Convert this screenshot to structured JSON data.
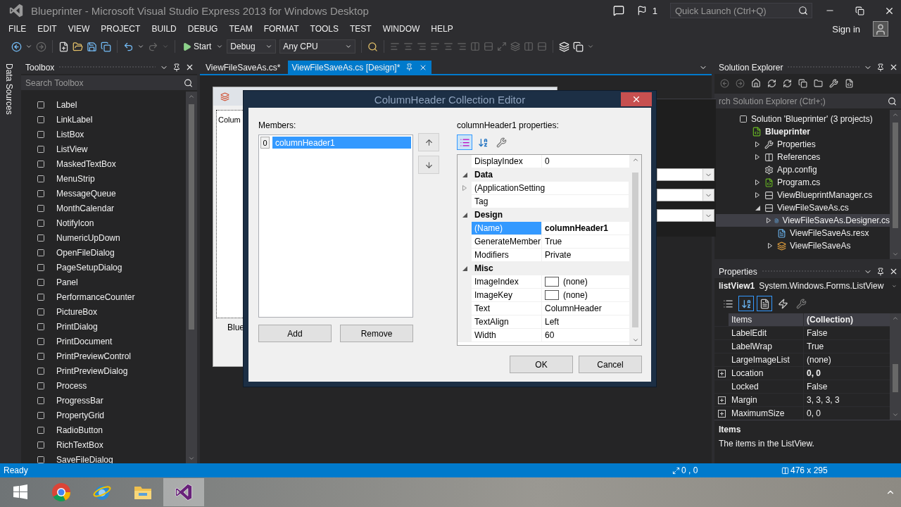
{
  "window": {
    "title": "Blueprinter - Microsoft Visual Studio Express 2013 for Windows Desktop",
    "notification_count": "1",
    "quick_launch": {
      "placeholder": "Quick Launch (Ctrl+Q)"
    },
    "sign_in": "Sign in"
  },
  "menu": [
    "FILE",
    "EDIT",
    "VIEW",
    "PROJECT",
    "BUILD",
    "DEBUG",
    "TEAM",
    "FORMAT",
    "TOOLS",
    "TEST",
    "WINDOW",
    "HELP"
  ],
  "toolbar": {
    "start": "Start",
    "configuration": "Debug",
    "platform": "Any CPU"
  },
  "side_tab": "Data Sources",
  "toolbox": {
    "title": "Toolbox",
    "search": {
      "placeholder": "Search Toolbox"
    },
    "items": [
      "Label",
      "LinkLabel",
      "ListBox",
      "ListView",
      "MaskedTextBox",
      "MenuStrip",
      "MessageQueue",
      "MonthCalendar",
      "NotifyIcon",
      "NumericUpDown",
      "OpenFileDialog",
      "PageSetupDialog",
      "Panel",
      "PerformanceCounter",
      "PictureBox",
      "PrintDialog",
      "PrintDocument",
      "PrintPreviewControl",
      "PrintPreviewDialog",
      "Process",
      "ProgressBar",
      "PropertyGrid",
      "RadioButton",
      "RichTextBox",
      "SaveFileDialog"
    ]
  },
  "document_tabs": [
    {
      "label": "ViewFileSaveAs.cs*",
      "selected": false
    },
    {
      "label": "ViewFileSaveAs.cs [Design]*",
      "selected": true
    }
  ],
  "designer": {
    "list_header": "Colum",
    "label": "Blue"
  },
  "dialog": {
    "title": "ColumnHeader Collection Editor",
    "members_label": "Members:",
    "members": [
      {
        "index": "0",
        "name": "columnHeader1",
        "selected": true
      }
    ],
    "add": "Add",
    "remove": "Remove",
    "properties_label": "columnHeader1 properties:",
    "view_buttons": [
      {
        "kind": "categorized",
        "selected": true
      },
      {
        "kind": "alphabetical",
        "selected": false
      },
      {
        "kind": "pages",
        "selected": false
      }
    ],
    "rows": [
      {
        "kind": "property",
        "name": "DisplayIndex",
        "value": "0",
        "selected": false,
        "bold": false
      },
      {
        "kind": "category",
        "name": "Data",
        "expanded": true
      },
      {
        "kind": "property",
        "name": "(ApplicationSetting",
        "expanded": false,
        "selected": false
      },
      {
        "kind": "property",
        "name": "Tag",
        "selected": false
      },
      {
        "kind": "category",
        "name": "Design",
        "expanded": true
      },
      {
        "kind": "property",
        "name": "(Name)",
        "value": "columnHeader1",
        "selected": true,
        "bold": true
      },
      {
        "kind": "property",
        "name": "GenerateMember",
        "value": "True",
        "selected": false,
        "bold": false
      },
      {
        "kind": "property",
        "name": "Modifiers",
        "value": "Private",
        "selected": false,
        "bold": false
      },
      {
        "kind": "category",
        "name": "Misc",
        "expanded": true
      },
      {
        "kind": "swatch",
        "name": "ImageIndex",
        "value": "(none)",
        "selected": false,
        "bold": false
      },
      {
        "kind": "swatch",
        "name": "ImageKey",
        "value": "(none)",
        "selected": false,
        "bold": false
      },
      {
        "kind": "property",
        "name": "Text",
        "value": "ColumnHeader",
        "selected": false,
        "bold": false
      },
      {
        "kind": "property",
        "name": "TextAlign",
        "value": "Left",
        "selected": false,
        "bold": false
      },
      {
        "kind": "property",
        "name": "Width",
        "value": "60",
        "selected": false,
        "bold": false
      }
    ],
    "ok": "OK",
    "cancel": "Cancel"
  },
  "solution_explorer": {
    "title": "Solution Explorer",
    "search": {
      "placeholder": "rch Solution Explorer (Ctrl+;)"
    },
    "tree": [
      {
        "label": "Solution 'Blueprinter' (3 projects)",
        "kind": "solution",
        "selected": false,
        "children": [
          {
            "label": "Blueprinter",
            "kind": "project",
            "selected": false,
            "children": [
              {
                "label": "Properties",
                "kind": "properties",
                "expanded": false,
                "selected": false
              },
              {
                "label": "References",
                "kind": "references",
                "expanded": false,
                "selected": false
              },
              {
                "label": "App.config",
                "kind": "config",
                "selected": false
              },
              {
                "label": "Program.cs",
                "kind": "csharp",
                "expanded": false,
                "selected": false
              },
              {
                "label": "ViewBlueprintManager.cs",
                "kind": "form",
                "expanded": false,
                "selected": false
              },
              {
                "label": "ViewFileSaveAs.cs",
                "kind": "form",
                "expanded": true,
                "selected": false,
                "children": [
                  {
                    "label": "ViewFileSaveAs.Designer.cs",
                    "kind": "file",
                    "expanded": false,
                    "selected": true
                  },
                  {
                    "label": "ViewFileSaveAs.resx",
                    "kind": "file",
                    "selected": false
                  },
                  {
                    "label": "ViewFileSaveAs",
                    "kind": "class",
                    "expanded": false,
                    "selected": false
                  }
                ]
              }
            ]
          }
        ]
      }
    ]
  },
  "properties": {
    "title": "Properties",
    "object": "listView1",
    "type": "System.Windows.Forms.ListView",
    "view_buttons": [
      {
        "kind": "categorized",
        "selected": false
      },
      {
        "kind": "alphabetical",
        "selected": true
      },
      {
        "kind": "properties",
        "selected": true
      },
      {
        "kind": "events",
        "selected": false
      },
      {
        "kind": "pages",
        "selected": false
      }
    ],
    "rows": [
      {
        "kind": "property",
        "name": "Items",
        "value": "(Collection)",
        "selected": true,
        "bold": true
      },
      {
        "kind": "property",
        "name": "LabelEdit",
        "value": "False",
        "selected": false,
        "bold": false
      },
      {
        "kind": "property",
        "name": "LabelWrap",
        "value": "True",
        "selected": false,
        "bold": false
      },
      {
        "kind": "property",
        "name": "LargeImageList",
        "value": "(none)",
        "selected": false,
        "bold": false
      },
      {
        "kind": "property",
        "name": "Location",
        "value": "0, 0",
        "expanded": false,
        "selected": false,
        "bold": true
      },
      {
        "kind": "property",
        "name": "Locked",
        "value": "False",
        "selected": false,
        "bold": false
      },
      {
        "kind": "property",
        "name": "Margin",
        "value": "3, 3, 3, 3",
        "expanded": false,
        "selected": false,
        "bold": false
      },
      {
        "kind": "property",
        "name": "MaximumSize",
        "value": "0, 0",
        "expanded": false,
        "selected": false,
        "bold": false
      }
    ],
    "description_title": "Items",
    "description": "The items in the ListView."
  },
  "status_bar": {
    "text": "Ready",
    "position": "0 , 0",
    "size": "476 x 295"
  }
}
